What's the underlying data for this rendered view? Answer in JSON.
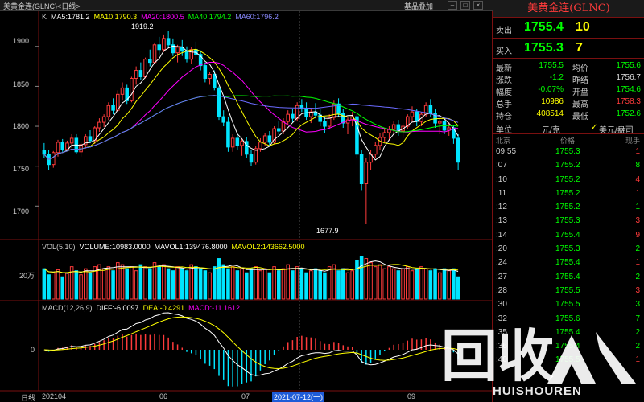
{
  "window": {
    "title": "美黄金连(GLNC)<日线>",
    "action": "基品叠加"
  },
  "indicators": {
    "k_label": "K",
    "ma5": "MA5:1781.2",
    "ma10": "MA10:1790.3",
    "ma20": "MA20:1800.5",
    "ma40": "MA40:1794.2",
    "ma60": "MA60:1796.2",
    "vol": "VOL(5,10)",
    "volume": "VOLUME:10983.0000",
    "mavol1": "MAVOL1:139476.8000",
    "mavol2": "MAVOL2:143662.5000",
    "macd": "MACD(12,26,9)",
    "diff": "DIFF:-6.0097",
    "dea": "DEA:-0.4291",
    "macdv": "MACD:-11.1612"
  },
  "colors": {
    "up": "#ff3b3b",
    "down": "#00e5ff",
    "ma5": "#ffffff",
    "ma10": "#ffff00",
    "ma20": "#ff00ff",
    "ma40": "#00ff00",
    "ma60": "#6b6bff"
  },
  "price_axis": [
    "1900",
    "1850",
    "1800",
    "1750",
    "1700"
  ],
  "vol_axis": "20万",
  "macd_axis": "0",
  "annotations": {
    "high": "1919.2",
    "low": "1677.9"
  },
  "date_axis": {
    "period": "日线",
    "start": "202104",
    "m06": "06",
    "m07": "07",
    "highlight": "2021-07-12(一)",
    "m09": "09"
  },
  "chart_data": {
    "type": "candlestick",
    "price_ylim": [
      1660,
      1930
    ],
    "candles": [
      [
        1770,
        1779,
        1760,
        1765
      ],
      [
        1765,
        1770,
        1745,
        1752
      ],
      [
        1752,
        1769,
        1748,
        1767
      ],
      [
        1767,
        1783,
        1762,
        1780
      ],
      [
        1780,
        1784,
        1768,
        1771
      ],
      [
        1771,
        1782,
        1769,
        1779
      ],
      [
        1779,
        1790,
        1773,
        1785
      ],
      [
        1785,
        1790,
        1765,
        1768
      ],
      [
        1768,
        1780,
        1762,
        1777
      ],
      [
        1777,
        1790,
        1772,
        1787
      ],
      [
        1787,
        1795,
        1779,
        1782
      ],
      [
        1782,
        1800,
        1778,
        1798
      ],
      [
        1798,
        1810,
        1793,
        1805
      ],
      [
        1805,
        1815,
        1799,
        1812
      ],
      [
        1812,
        1830,
        1808,
        1826
      ],
      [
        1826,
        1835,
        1815,
        1820
      ],
      [
        1820,
        1845,
        1818,
        1840
      ],
      [
        1840,
        1855,
        1832,
        1848
      ],
      [
        1848,
        1852,
        1828,
        1832
      ],
      [
        1832,
        1862,
        1830,
        1860
      ],
      [
        1860,
        1875,
        1852,
        1870
      ],
      [
        1870,
        1880,
        1858,
        1862
      ],
      [
        1862,
        1886,
        1860,
        1884
      ],
      [
        1884,
        1896,
        1875,
        1880
      ],
      [
        1880,
        1905,
        1878,
        1902
      ],
      [
        1902,
        1912,
        1890,
        1896
      ],
      [
        1896,
        1915,
        1893,
        1910
      ],
      [
        1910,
        1919,
        1898,
        1902
      ],
      [
        1902,
        1910,
        1888,
        1892
      ],
      [
        1892,
        1902,
        1880,
        1899
      ],
      [
        1899,
        1908,
        1888,
        1894
      ],
      [
        1894,
        1900,
        1880,
        1884
      ],
      [
        1884,
        1899,
        1878,
        1896
      ],
      [
        1896,
        1906,
        1885,
        1890
      ],
      [
        1890,
        1895,
        1870,
        1876
      ],
      [
        1876,
        1880,
        1855,
        1860
      ],
      [
        1860,
        1868,
        1852,
        1865
      ],
      [
        1865,
        1870,
        1845,
        1848
      ],
      [
        1848,
        1850,
        1808,
        1812
      ],
      [
        1812,
        1820,
        1800,
        1805
      ],
      [
        1805,
        1812,
        1768,
        1774
      ],
      [
        1774,
        1790,
        1768,
        1785
      ],
      [
        1785,
        1790,
        1770,
        1776
      ],
      [
        1776,
        1785,
        1763,
        1781
      ],
      [
        1781,
        1786,
        1760,
        1765
      ],
      [
        1765,
        1770,
        1750,
        1755
      ],
      [
        1755,
        1775,
        1752,
        1772
      ],
      [
        1772,
        1785,
        1768,
        1780
      ],
      [
        1780,
        1792,
        1775,
        1788
      ],
      [
        1788,
        1794,
        1776,
        1780
      ],
      [
        1780,
        1800,
        1778,
        1797
      ],
      [
        1797,
        1806,
        1790,
        1794
      ],
      [
        1794,
        1810,
        1790,
        1806
      ],
      [
        1806,
        1820,
        1802,
        1815
      ],
      [
        1815,
        1822,
        1805,
        1810
      ],
      [
        1810,
        1830,
        1806,
        1826
      ],
      [
        1826,
        1834,
        1818,
        1822
      ],
      [
        1822,
        1830,
        1808,
        1812
      ],
      [
        1812,
        1822,
        1804,
        1818
      ],
      [
        1818,
        1829,
        1810,
        1814
      ],
      [
        1814,
        1822,
        1800,
        1806
      ],
      [
        1806,
        1812,
        1792,
        1800
      ],
      [
        1800,
        1815,
        1796,
        1811
      ],
      [
        1811,
        1832,
        1808,
        1828
      ],
      [
        1828,
        1835,
        1812,
        1816
      ],
      [
        1816,
        1822,
        1798,
        1804
      ],
      [
        1804,
        1812,
        1790,
        1808
      ],
      [
        1808,
        1818,
        1800,
        1812
      ],
      [
        1812,
        1815,
        1760,
        1765
      ],
      [
        1765,
        1770,
        1720,
        1728
      ],
      [
        1728,
        1760,
        1678,
        1755
      ],
      [
        1755,
        1770,
        1745,
        1765
      ],
      [
        1765,
        1780,
        1760,
        1776
      ],
      [
        1776,
        1792,
        1770,
        1786
      ],
      [
        1786,
        1798,
        1780,
        1792
      ],
      [
        1792,
        1800,
        1782,
        1796
      ],
      [
        1796,
        1806,
        1790,
        1802
      ],
      [
        1802,
        1808,
        1788,
        1794
      ],
      [
        1794,
        1804,
        1785,
        1800
      ],
      [
        1800,
        1815,
        1796,
        1812
      ],
      [
        1812,
        1825,
        1805,
        1818
      ],
      [
        1818,
        1822,
        1800,
        1806
      ],
      [
        1806,
        1818,
        1800,
        1815
      ],
      [
        1815,
        1830,
        1812,
        1826
      ],
      [
        1826,
        1834,
        1812,
        1816
      ],
      [
        1816,
        1822,
        1798,
        1804
      ],
      [
        1804,
        1810,
        1790,
        1806
      ],
      [
        1806,
        1812,
        1790,
        1795
      ],
      [
        1795,
        1805,
        1788,
        1798
      ],
      [
        1798,
        1802,
        1778,
        1785
      ],
      [
        1785,
        1790,
        1745,
        1755
      ]
    ],
    "volumes_k": [
      150,
      120,
      130,
      145,
      110,
      130,
      160,
      140,
      120,
      150,
      130,
      160,
      170,
      150,
      160,
      140,
      180,
      170,
      150,
      160,
      140,
      170,
      160,
      150,
      180,
      160,
      170,
      150,
      140,
      160,
      150,
      140,
      170,
      160,
      150,
      140,
      130,
      160,
      200,
      170,
      150,
      160,
      140,
      150,
      130,
      150,
      160,
      140,
      150,
      130,
      160,
      140,
      150,
      170,
      140,
      160,
      150,
      130,
      140,
      150,
      140,
      130,
      160,
      170,
      140,
      150,
      130,
      140,
      190,
      210,
      200,
      180,
      160,
      170,
      150,
      160,
      150,
      140,
      150,
      160,
      140,
      150,
      160,
      150,
      140,
      150,
      130,
      150,
      140,
      150,
      110
    ],
    "macd_axis_ref": 0
  },
  "quote": {
    "header": "美黄金连(GLNC)",
    "sell_label": "卖出",
    "sell_price": "1755.4",
    "sell_qty": "10",
    "buy_label": "买入",
    "buy_price": "1755.3",
    "buy_qty": "7",
    "rows": [
      {
        "k1": "最新",
        "v1": "1755.5",
        "c1": "#00ff00",
        "k2": "均价",
        "v2": "1755.6",
        "c2": "#00ff00"
      },
      {
        "k1": "涨跌",
        "v1": "-1.2",
        "c1": "#00ff00",
        "k2": "昨结",
        "v2": "1756.7",
        "c2": "#dddddd"
      },
      {
        "k1": "幅度",
        "v1": "-0.07%",
        "c1": "#00ff00",
        "k2": "开盘",
        "v2": "1754.6",
        "c2": "#00ff00"
      },
      {
        "k1": "总手",
        "v1": "10986",
        "c1": "#ffff00",
        "k2": "最高",
        "v2": "1758.3",
        "c2": "#ff3b3b"
      },
      {
        "k1": "持仓",
        "v1": "408514",
        "c1": "#ffff00",
        "k2": "最低",
        "v2": "1752.6",
        "c2": "#00ff00"
      }
    ],
    "unit_label": "单位",
    "unit_value": "元/克",
    "unit_alt": "美元/盎司",
    "city": "北京",
    "price_head": "价格",
    "qty_head": "现手",
    "ticks": [
      {
        "t": "09:55",
        "p": "1755.3",
        "q": "1",
        "qc": "#ff3b3b"
      },
      {
        "t": ":07",
        "p": "1755.2",
        "q": "8",
        "qc": "#00ff00"
      },
      {
        "t": ":10",
        "p": "1755.2",
        "q": "4",
        "qc": "#ff3b3b"
      },
      {
        "t": ":11",
        "p": "1755.2",
        "q": "1",
        "qc": "#ff3b3b"
      },
      {
        "t": ":12",
        "p": "1755.2",
        "q": "1",
        "qc": "#00ff00"
      },
      {
        "t": ":13",
        "p": "1755.3",
        "q": "3",
        "qc": "#ff3b3b"
      },
      {
        "t": ":14",
        "p": "1755.4",
        "q": "9",
        "qc": "#ff3b3b"
      },
      {
        "t": ":20",
        "p": "1755.3",
        "q": "2",
        "qc": "#00ff00"
      },
      {
        "t": ":24",
        "p": "1755.4",
        "q": "1",
        "qc": "#ff3b3b"
      },
      {
        "t": ":27",
        "p": "1755.4",
        "q": "2",
        "qc": "#00ff00"
      },
      {
        "t": ":28",
        "p": "1755.5",
        "q": "3",
        "qc": "#ff3b3b"
      },
      {
        "t": ":30",
        "p": "1755.5",
        "q": "3",
        "qc": "#00ff00"
      },
      {
        "t": ":32",
        "p": "1755.6",
        "q": "7",
        "qc": "#00ff00"
      },
      {
        "t": ":35",
        "p": "1755.4",
        "q": "2",
        "qc": "#00ff00"
      },
      {
        "t": ":36",
        "p": "1755.4",
        "q": "2",
        "qc": "#00ff00"
      },
      {
        "t": ":40",
        "p": "1755.5",
        "q": "1",
        "qc": "#ff3b3b"
      }
    ]
  },
  "watermark": {
    "main": "回收",
    "sub": "HUISHOUREN"
  }
}
